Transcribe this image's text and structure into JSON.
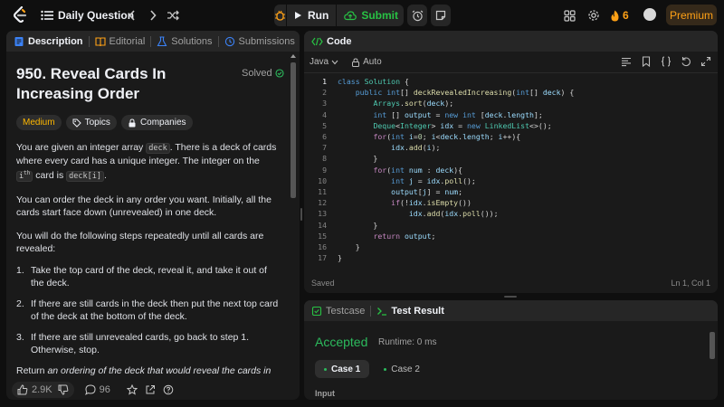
{
  "topbar": {
    "title": "Daily Question",
    "run_label": "Run",
    "submit_label": "Submit",
    "streak_count": "6",
    "premium_label": "Premium"
  },
  "left_tabs": [
    {
      "label": "Description",
      "active": true
    },
    {
      "label": "Editorial",
      "active": false
    },
    {
      "label": "Solutions",
      "active": false
    },
    {
      "label": "Submissions",
      "active": false
    }
  ],
  "problem": {
    "title": "950. Reveal Cards In Increasing Order",
    "status": "Solved",
    "difficulty": "Medium",
    "topics_label": "Topics",
    "companies_label": "Companies",
    "p1_a": "You are given an integer array ",
    "p1_code1": "deck",
    "p1_b": ". There is a deck of cards where every card has a unique integer. The integer on the ",
    "p1_code2": "i",
    "p1_sup": "th",
    "p1_c": " card is ",
    "p1_code3": "deck[i]",
    "p1_d": ".",
    "p2": "You can order the deck in any order you want. Initially, all the cards start face down (unrevealed) in one deck.",
    "p3": "You will do the following steps repeatedly until all cards are revealed:",
    "steps": [
      "Take the top card of the deck, reveal it, and take it out of the deck.",
      "If there are still cards in the deck then put the next top card of the deck at the bottom of the deck.",
      "If there are still unrevealed cards, go back to step 1. Otherwise, stop."
    ],
    "p4_a": "Return ",
    "p4_b": "an ordering of the deck that would reveal the cards in"
  },
  "bottom_bar": {
    "likes": "2.9K",
    "comments": "96"
  },
  "code": {
    "tab_label": "Code",
    "language": "Java",
    "mode": "Auto",
    "status_left": "Saved",
    "status_right": "Ln 1, Col 1"
  },
  "test": {
    "tab_testcase": "Testcase",
    "tab_result": "Test Result",
    "verdict": "Accepted",
    "runtime": "Runtime: 0 ms",
    "cases": [
      "Case 1",
      "Case 2"
    ],
    "input_label": "Input"
  },
  "colors": {
    "accent": "#ffa116",
    "accepted": "#2cbb5d",
    "medium": "#ffb800"
  }
}
